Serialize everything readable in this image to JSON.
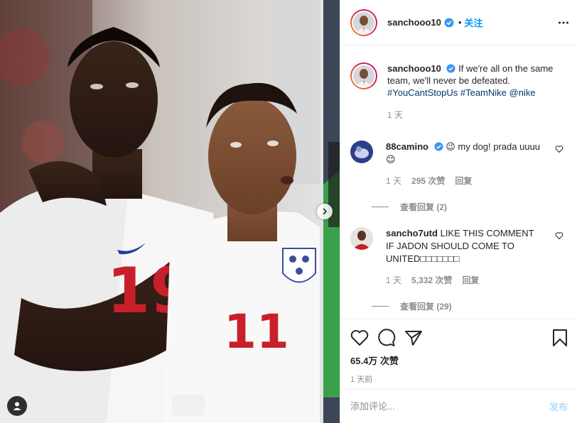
{
  "header": {
    "username": "sanchooo10",
    "dot": "•",
    "follow_label": "关注"
  },
  "caption": {
    "username": "sanchooo10",
    "text": "If we're all on the same team, we'll never be defeated.",
    "hashtags": "#YouCantStopUs #TeamNike @nike",
    "time": "1 天"
  },
  "comments": [
    {
      "username": "88camino",
      "text": "😉 my dog! prada uuuu 😉",
      "time": "1 天",
      "likes": "295 次赞",
      "reply_label": "回复",
      "view_replies": "查看回复 (2)"
    },
    {
      "username": "sancho7utd",
      "text": "LIKE THIS COMMENT IF JADON SHOULD COME TO UNITED□□□□□□□",
      "time": "1 天",
      "likes": "5,332 次赞",
      "reply_label": "回复",
      "view_replies": "查看回复 (29)"
    }
  ],
  "actions": {
    "likes": "65.4万 次赞",
    "posted_ago": "1 天前"
  },
  "add_comment": {
    "placeholder": "添加评论...",
    "post_label": "发布"
  },
  "photo": {
    "player_left_number": "19",
    "player_right_number": "11"
  },
  "colors": {
    "accent": "#0095f6",
    "verified": "#3897f0",
    "hashtag": "#00376b",
    "muted": "#8e8e8e",
    "post_disabled": "#b2dffc"
  },
  "icons": [
    "verified-icon",
    "more-options-icon",
    "heart-icon",
    "comment-icon",
    "share-icon",
    "bookmark-icon",
    "chevron-right-icon",
    "user-tag-icon"
  ]
}
